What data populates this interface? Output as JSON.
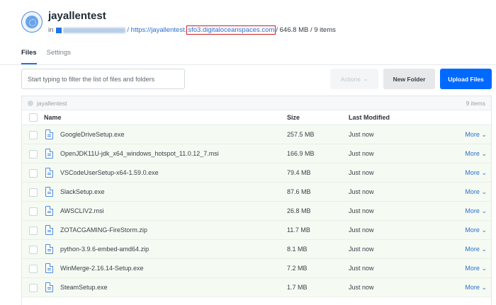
{
  "bucket": {
    "name": "jayallentest",
    "in_label": "in",
    "url_prefix": "/ https://jayallentest.",
    "url_host": "sfo3.digitaloceanspaces.com",
    "usage": "/ 646.8 MB / 9 items"
  },
  "tabs": [
    {
      "label": "Files",
      "active": true
    },
    {
      "label": "Settings",
      "active": false
    }
  ],
  "toolbar": {
    "filter_placeholder": "Start typing to filter the list of files and folders",
    "actions_label": "Actions",
    "new_folder_label": "New Folder",
    "upload_label": "Upload Files"
  },
  "table": {
    "path": "jayallentest",
    "count": "9 items",
    "columns": {
      "name": "Name",
      "size": "Size",
      "modified": "Last Modified"
    },
    "rows": [
      {
        "name": "GoogleDriveSetup.exe",
        "size": "257.5 MB",
        "modified": "Just now",
        "more": "More"
      },
      {
        "name": "OpenJDK11U-jdk_x64_windows_hotspot_11.0.12_7.msi",
        "size": "166.9 MB",
        "modified": "Just now",
        "more": "More"
      },
      {
        "name": "VSCodeUserSetup-x64-1.59.0.exe",
        "size": "79.4 MB",
        "modified": "Just now",
        "more": "More"
      },
      {
        "name": "SlackSetup.exe",
        "size": "87.6 MB",
        "modified": "Just now",
        "more": "More"
      },
      {
        "name": "AWSCLIV2.msi",
        "size": "26.8 MB",
        "modified": "Just now",
        "more": "More"
      },
      {
        "name": "ZOTACGAMING-FireStorm.zip",
        "size": "11.7 MB",
        "modified": "Just now",
        "more": "More"
      },
      {
        "name": "python-3.9.6-embed-amd64.zip",
        "size": "8.1 MB",
        "modified": "Just now",
        "more": "More"
      },
      {
        "name": "WinMerge-2.16.14-Setup.exe",
        "size": "7.2 MB",
        "modified": "Just now",
        "more": "More"
      },
      {
        "name": "SteamSetup.exe",
        "size": "1.7 MB",
        "modified": "Just now",
        "more": "More"
      }
    ]
  },
  "colors": {
    "accent": "#0069ff",
    "link": "#2b6fcf",
    "highlight_box": "#d0202a",
    "row_bg": "#f5fbf3"
  },
  "icons": {
    "bucket_avatar": "spaces-bucket-icon",
    "file": "file-icon",
    "chevron": "chevron-down-icon"
  }
}
